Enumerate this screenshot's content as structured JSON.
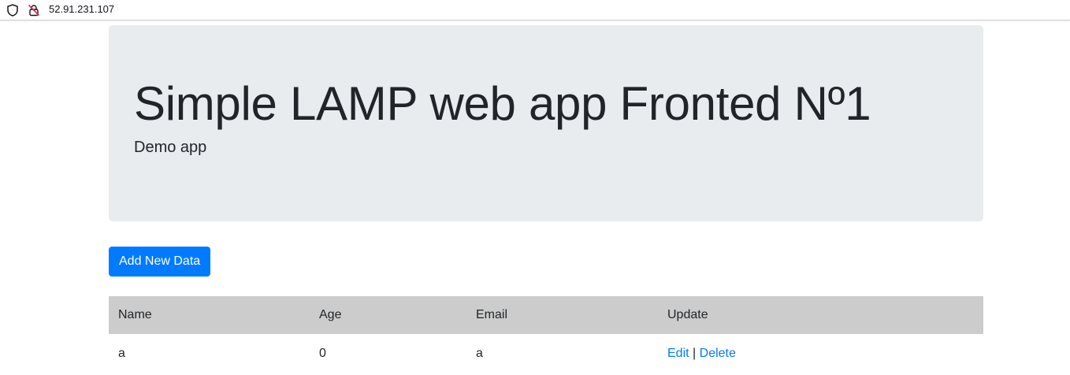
{
  "browser": {
    "url": "52.91.231.107"
  },
  "header": {
    "title": "Simple LAMP web app Fronted Nº1",
    "subtitle": "Demo app"
  },
  "actions": {
    "add_label": "Add New Data"
  },
  "table": {
    "columns": [
      "Name",
      "Age",
      "Email",
      "Update"
    ],
    "rows": [
      {
        "name": "a",
        "age": "0",
        "email": "a",
        "edit_label": "Edit",
        "separator": "|",
        "delete_label": "Delete"
      }
    ]
  },
  "colors": {
    "primary": "#007bff",
    "jumbotron_bg": "#e9ecef",
    "table_header_bg": "#cccccc",
    "text": "#212529"
  }
}
